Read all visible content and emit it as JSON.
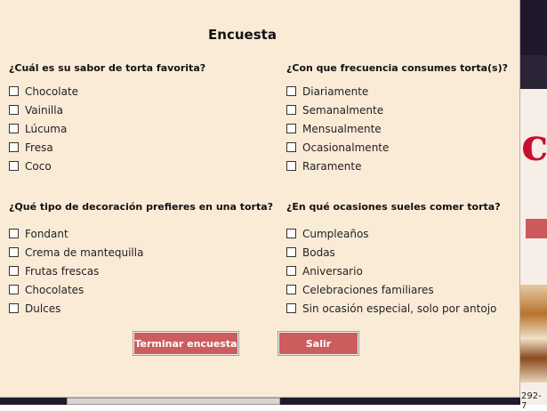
{
  "background": {
    "phone_fragment": "292-7"
  },
  "survey": {
    "title": "Encuesta",
    "groups": [
      {
        "question": "¿Cuál es su sabor de torta favorita?",
        "options": [
          "Chocolate",
          "Vainilla",
          "Lúcuma",
          "Fresa",
          "Coco"
        ]
      },
      {
        "question": "¿Con que frecuencia consumes torta(s)?",
        "options": [
          "Diariamente",
          "Semanalmente",
          "Mensualmente",
          "Ocasionalmente",
          "Raramente"
        ]
      },
      {
        "question": "¿Qué tipo de decoración prefieres en una torta?",
        "options": [
          "Fondant",
          "Crema de mantequilla",
          "Frutas frescas",
          "Chocolates",
          "Dulces"
        ]
      },
      {
        "question": "¿En qué ocasiones sueles comer torta?",
        "options": [
          "Cumpleaños",
          "Bodas",
          "Aniversario",
          "Celebraciones familiares",
          "Sin ocasión especial, solo por antojo"
        ]
      }
    ],
    "buttons": {
      "finish": "Terminar encuesta",
      "exit": "Salir"
    },
    "colors": {
      "dialog_bg": "#faebd7",
      "button_bg": "#cd5c5c",
      "button_text": "#ffffff"
    }
  }
}
